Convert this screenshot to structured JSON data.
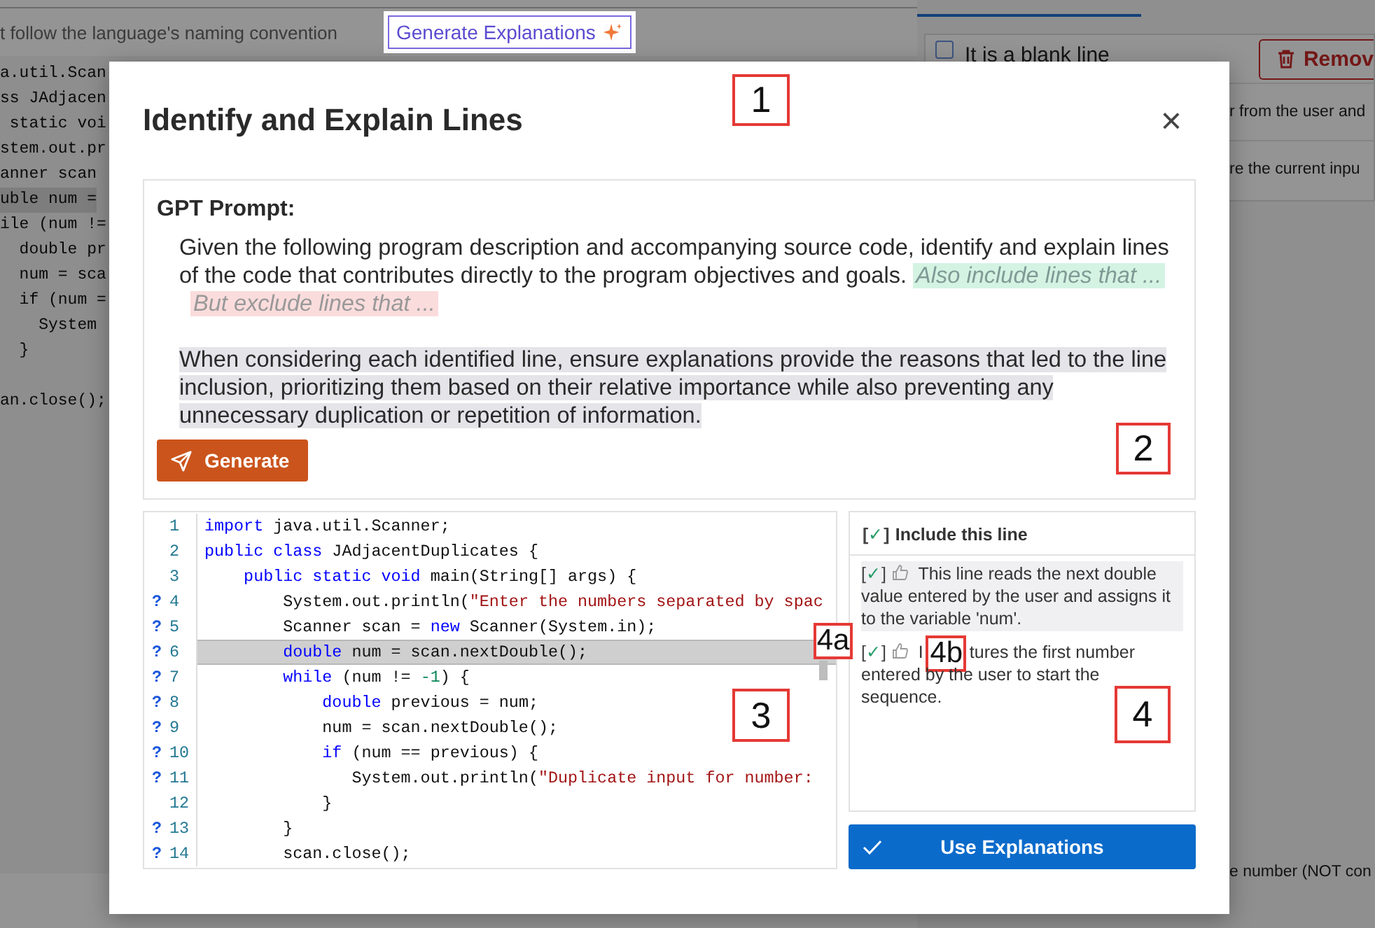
{
  "background": {
    "hint_text": "t follow the language's naming convention",
    "generate_button": {
      "label": "Generate Explanations"
    },
    "code_fragments": [
      {
        "text": "a.util.Scan",
        "selected": false
      },
      {
        "text": "ss JAdjacen",
        "selected": false
      },
      {
        "text": " static voi",
        "selected": false
      },
      {
        "text": "stem.out.pr",
        "selected": false
      },
      {
        "text": "anner scan",
        "selected": false
      },
      {
        "text": "uble num =",
        "selected": true
      },
      {
        "text": "ile (num !=",
        "selected": false
      },
      {
        "text": "  double pr",
        "selected": false
      },
      {
        "text": "  num = sca",
        "selected": false
      },
      {
        "text": "  if (num =",
        "selected": false
      },
      {
        "text": "    System",
        "selected": false
      },
      {
        "text": "  }",
        "selected": false
      },
      {
        "text": "an.close();",
        "selected": false
      }
    ],
    "checkbox": {
      "label": "It is a blank line",
      "checked": false
    },
    "remove_button": "Remov",
    "row_fragments": [
      "r from the user and",
      "re the current inpu"
    ],
    "footer_fragment": "e number (NOT con"
  },
  "dialog": {
    "title": "Identify and Explain Lines",
    "close": "×",
    "prompt": {
      "heading": "GPT Prompt:",
      "text": "Given the following program description and accompanying source code, identify and explain lines of the code that contributes directly to the program objectives and goals.",
      "include_hint": "Also include lines that ...",
      "exclude_hint": "But exclude lines that ...",
      "guidance": "When considering each identified line, ensure explanations provide the reasons that led to the line inclusion, prioritizing them based on their relative importance while also preventing any unnecessary duplication or repetition of information.",
      "button": "Generate"
    },
    "code": {
      "lines": [
        {
          "number": "1",
          "selected": false,
          "tokens": [
            {
              "text": "import",
              "kind": "keyword"
            },
            {
              "text": " java.util.Scanner;",
              "kind": "plain"
            }
          ]
        },
        {
          "number": "2",
          "selected": false,
          "tokens": [
            {
              "text": "public class",
              "kind": "keyword"
            },
            {
              "text": " JAdjacentDuplicates {",
              "kind": "plain"
            }
          ]
        },
        {
          "number": "3",
          "selected": false,
          "tokens": [
            {
              "text": "    public static void",
              "kind": "keyword"
            },
            {
              "text": " main(String[] args) {",
              "kind": "plain"
            }
          ]
        },
        {
          "number": "4",
          "marker": "?",
          "selected": false,
          "tokens": [
            {
              "text": "        System.out.println(",
              "kind": "plain"
            },
            {
              "text": "\"Enter the numbers separated by spac",
              "kind": "string"
            }
          ]
        },
        {
          "number": "5",
          "marker": "?",
          "selected": false,
          "tokens": [
            {
              "text": "        Scanner scan = ",
              "kind": "plain"
            },
            {
              "text": "new",
              "kind": "keyword"
            },
            {
              "text": " Scanner(System.in);",
              "kind": "plain"
            }
          ]
        },
        {
          "number": "6",
          "marker": "?",
          "selected": true,
          "tokens": [
            {
              "text": "        double",
              "kind": "keyword"
            },
            {
              "text": " num = scan.nextDouble();",
              "kind": "plain"
            }
          ]
        },
        {
          "number": "7",
          "marker": "?",
          "selected": false,
          "tokens": [
            {
              "text": "        while",
              "kind": "keyword"
            },
            {
              "text": " (num != ",
              "kind": "plain"
            },
            {
              "text": "-1",
              "kind": "number"
            },
            {
              "text": ") {",
              "kind": "plain"
            }
          ]
        },
        {
          "number": "8",
          "marker": "?",
          "selected": false,
          "tokens": [
            {
              "text": "            double",
              "kind": "keyword"
            },
            {
              "text": " previous = num;",
              "kind": "plain"
            }
          ]
        },
        {
          "number": "9",
          "marker": "?",
          "selected": false,
          "tokens": [
            {
              "text": "            num = scan.nextDouble();",
              "kind": "plain"
            }
          ]
        },
        {
          "number": "10",
          "marker": "?",
          "selected": false,
          "tokens": [
            {
              "text": "            if",
              "kind": "keyword"
            },
            {
              "text": " (num == previous) {",
              "kind": "plain"
            }
          ]
        },
        {
          "number": "11",
          "marker": "?",
          "selected": false,
          "tokens": [
            {
              "text": "               System.out.println(",
              "kind": "plain"
            },
            {
              "text": "\"Duplicate input for number:",
              "kind": "string"
            }
          ]
        },
        {
          "number": "12",
          "selected": false,
          "tokens": [
            {
              "text": "            }",
              "kind": "plain"
            }
          ]
        },
        {
          "number": "13",
          "marker": "?",
          "selected": false,
          "tokens": [
            {
              "text": "        }",
              "kind": "plain"
            }
          ]
        },
        {
          "number": "14",
          "marker": "?",
          "selected": false,
          "tokens": [
            {
              "text": "        scan.close();",
              "kind": "plain"
            }
          ]
        }
      ]
    },
    "explanations": {
      "header": {
        "mark": "[✓]",
        "checked": true,
        "label": "Include this line"
      },
      "items": [
        {
          "mark": "[✓]",
          "checked": true,
          "selected": true,
          "parts": [
            "This line reads the next double value entered by the user and assigns it to the variable 'num'."
          ]
        },
        {
          "mark": "[✓]",
          "checked": true,
          "selected": false,
          "parts": [
            "I",
            "tures the first number entered by the user to start the sequence."
          ],
          "annotation": "4b"
        }
      ]
    },
    "use_button": "Use Explanations"
  },
  "annotations": [
    "1",
    "2",
    "3",
    "4a",
    "4"
  ]
}
